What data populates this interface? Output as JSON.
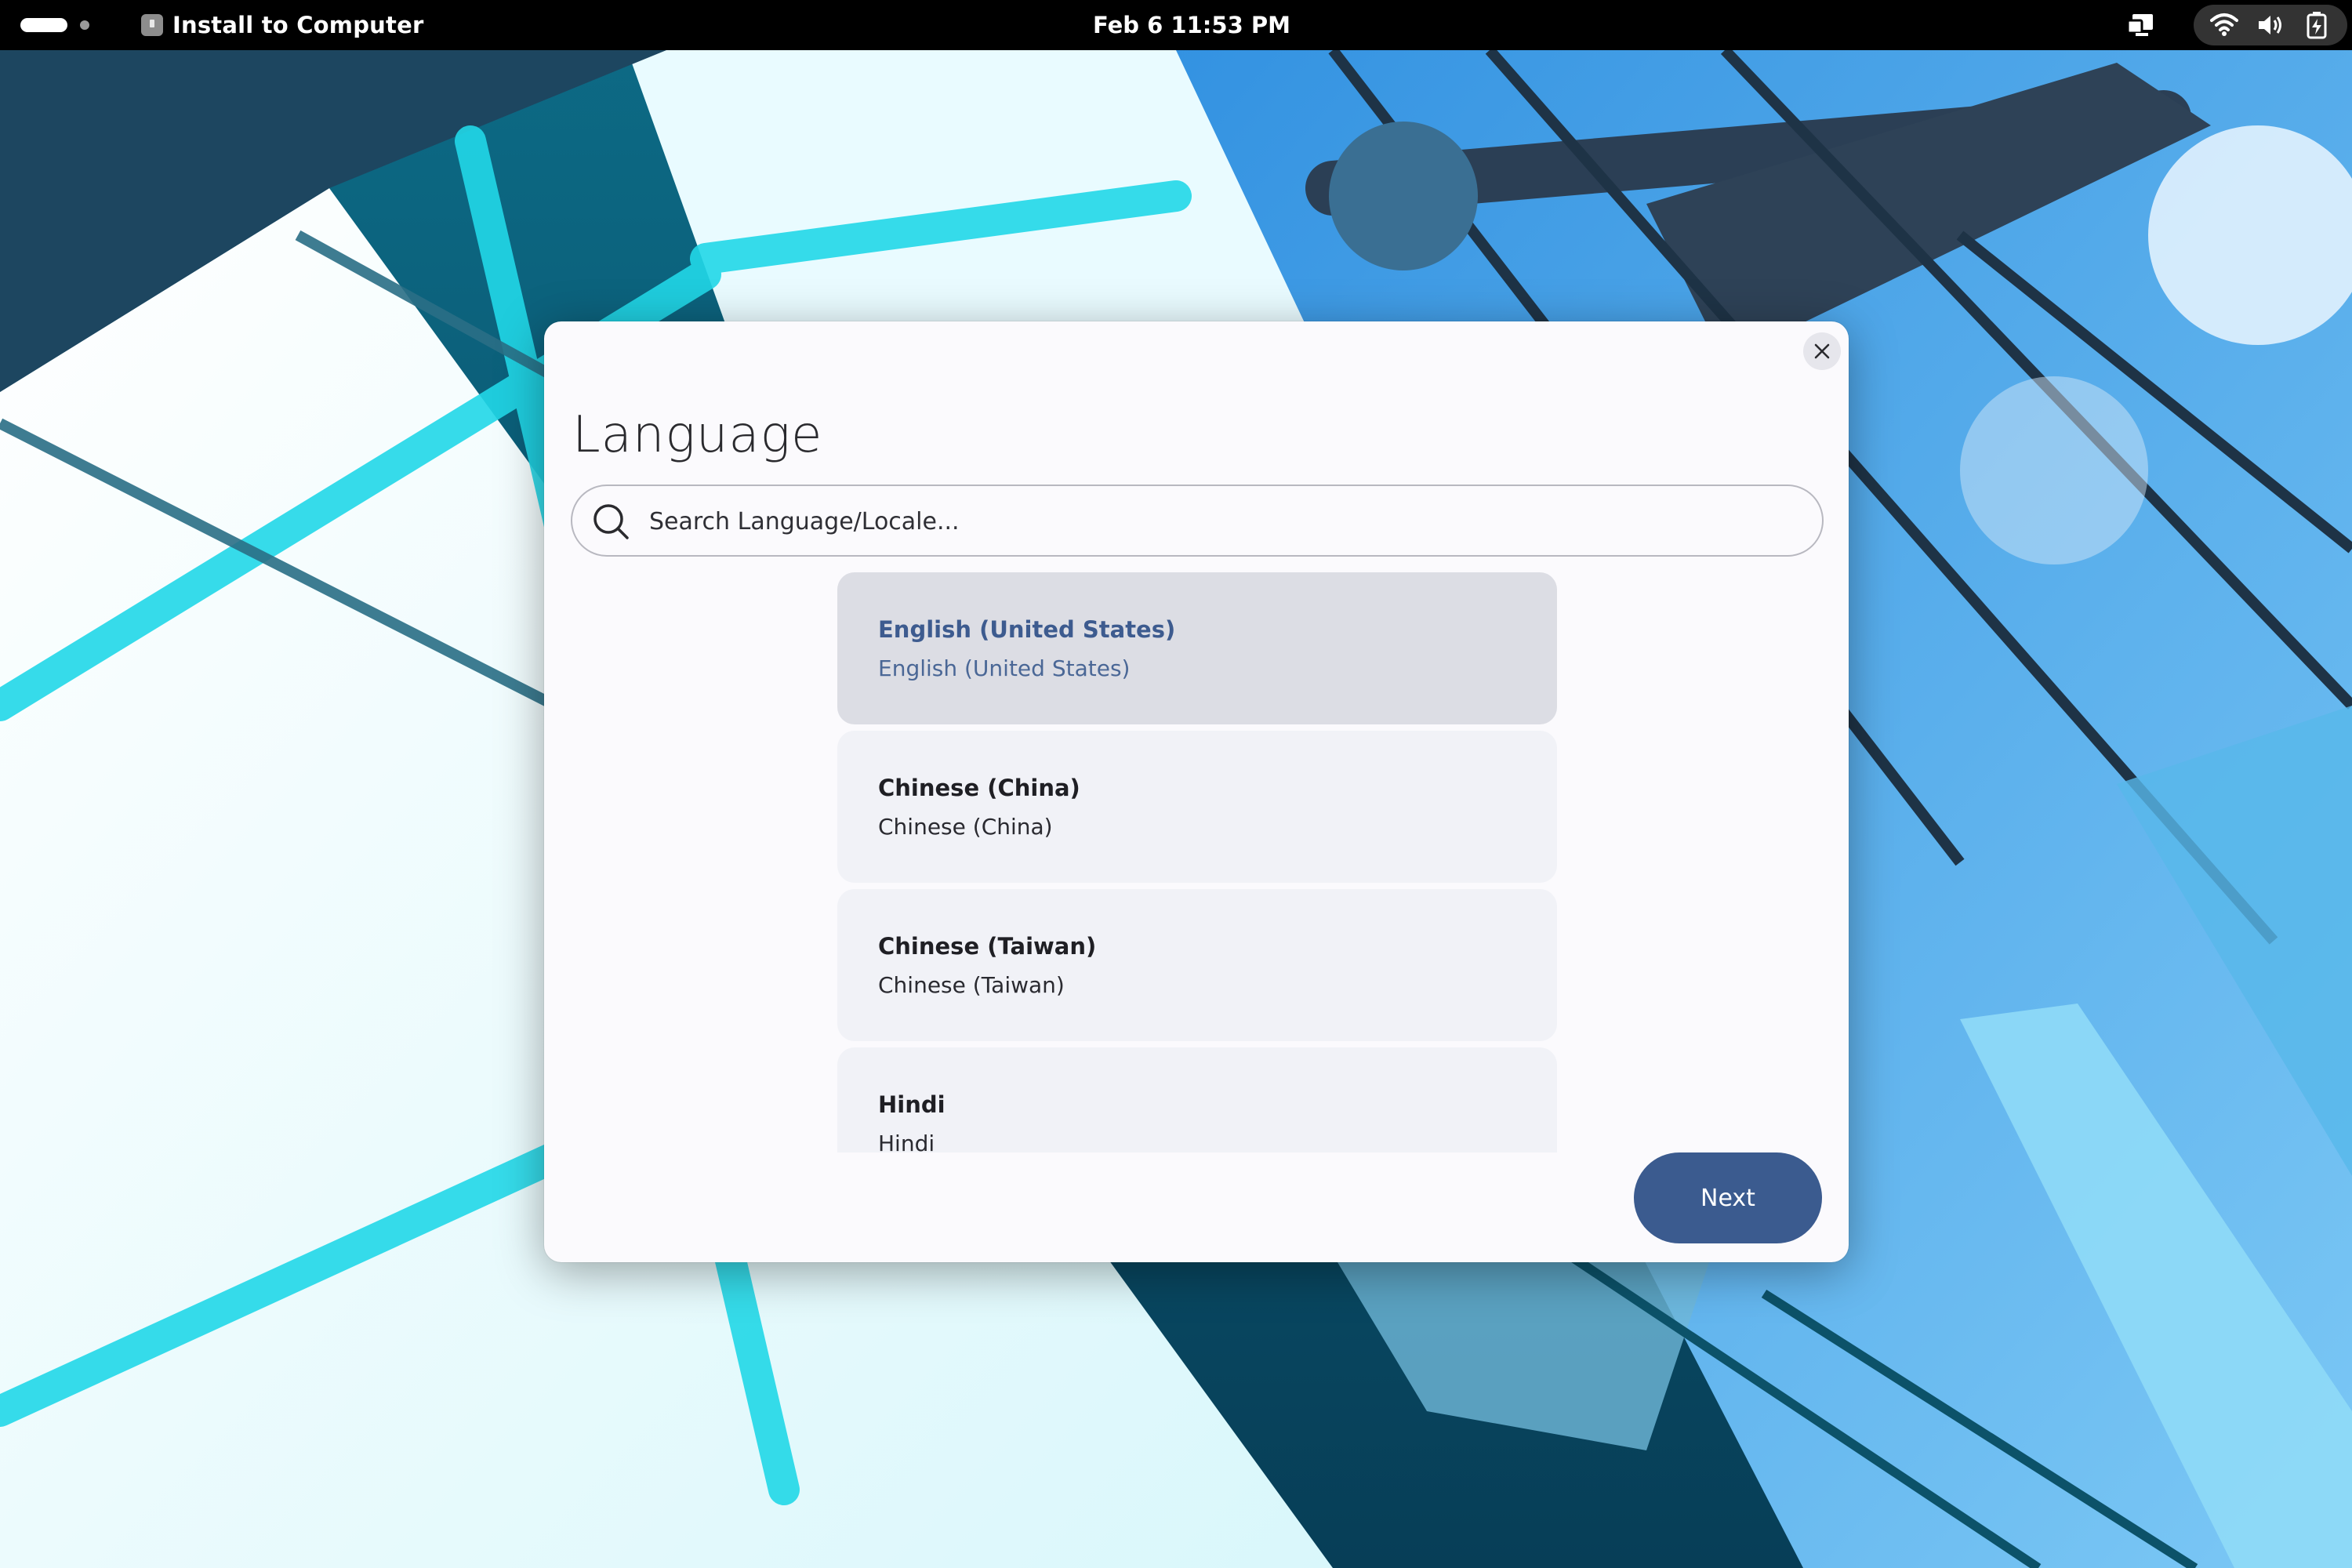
{
  "topbar": {
    "app_title": "Install to Computer",
    "clock": "Feb 6  11:53 PM",
    "icons": [
      "activities-indicator",
      "app-icon",
      "screen-share-icon",
      "wifi-icon",
      "volume-icon",
      "battery-icon"
    ]
  },
  "dialog": {
    "title": "Language",
    "search": {
      "placeholder": "Search Language/Locale...",
      "value": ""
    },
    "languages": [
      {
        "name": "English (United States)",
        "native": "English (United States)",
        "selected": true
      },
      {
        "name": "Chinese (China)",
        "native": "Chinese (China)",
        "selected": false
      },
      {
        "name": "Chinese (Taiwan)",
        "native": "Chinese (Taiwan)",
        "selected": false
      },
      {
        "name": "Hindi",
        "native": "Hindi",
        "selected": false
      }
    ],
    "next_label": "Next",
    "close_icon": "close-icon"
  },
  "colors": {
    "accent": "#3b5b8f",
    "selected_row": "#dcdde4",
    "row": "#f1f2f7",
    "dialog_bg": "#fbfafd",
    "topbar_bg": "#000000"
  }
}
